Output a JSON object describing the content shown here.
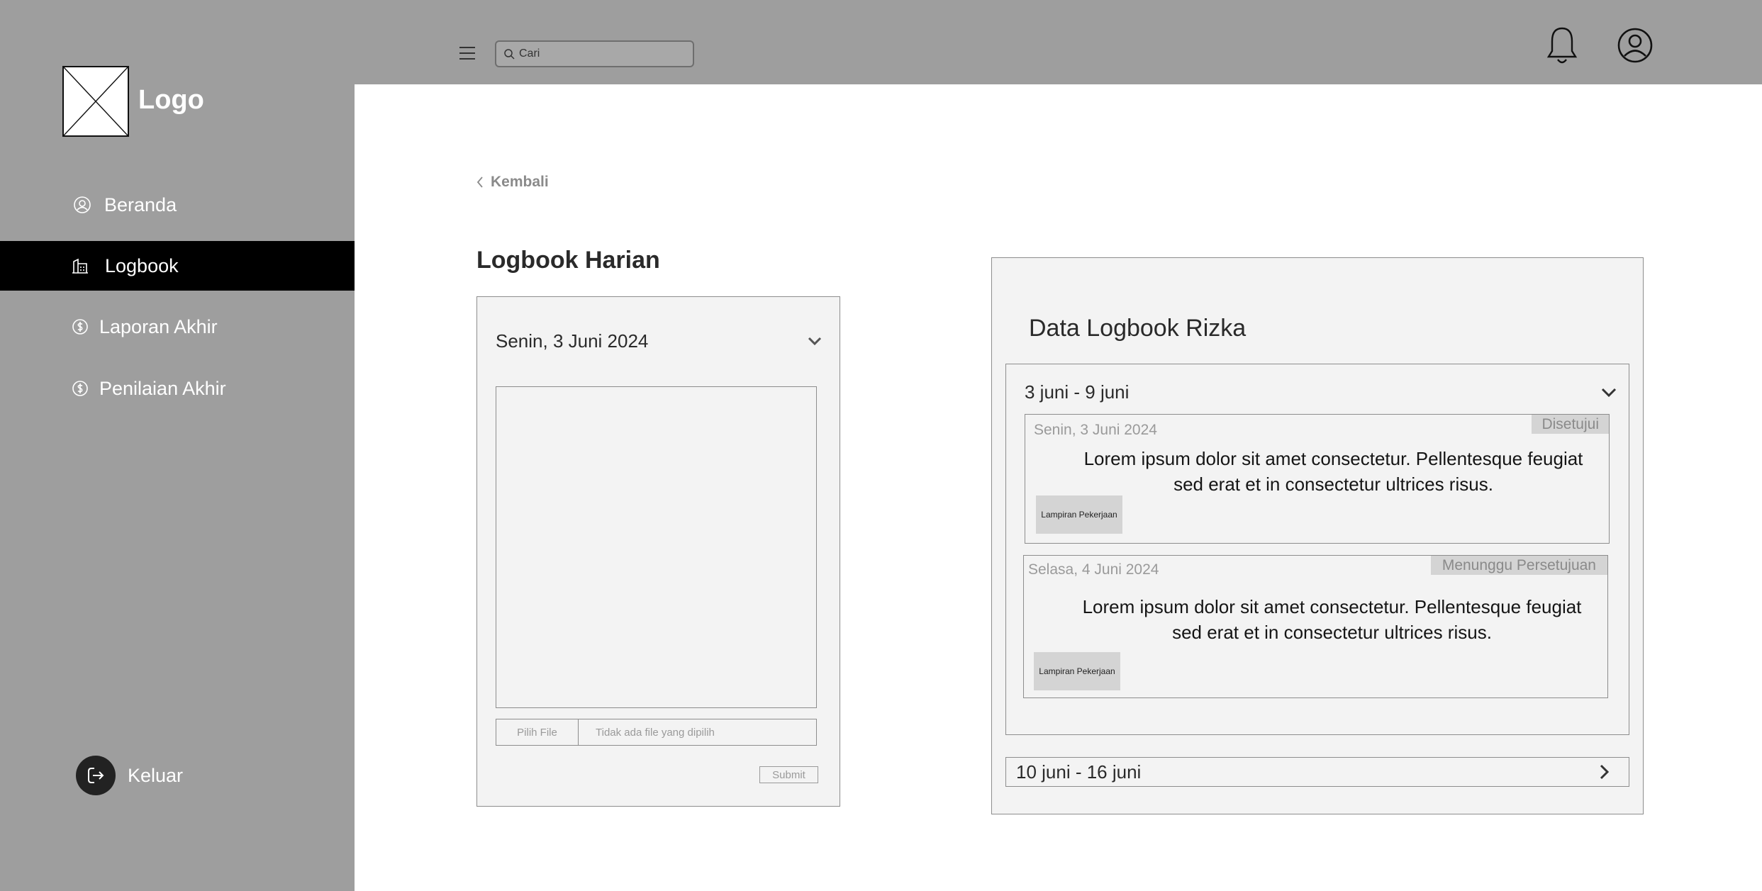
{
  "brand": {
    "logo_text": "Logo"
  },
  "sidebar": {
    "items": [
      {
        "label": "Beranda",
        "icon": "dashboard-icon",
        "active": false
      },
      {
        "label": "Logbook",
        "icon": "building-icon",
        "active": true
      },
      {
        "label": "Laporan Akhir",
        "icon": "dollar-icon",
        "active": false
      },
      {
        "label": "Penilaian Akhir",
        "icon": "dollar-icon",
        "active": false
      }
    ],
    "logout_label": "Keluar"
  },
  "topbar": {
    "search_placeholder": "Cari",
    "icons": [
      "menu-icon",
      "search-icon",
      "bell-icon",
      "user-profile-icon"
    ]
  },
  "content": {
    "back_label": "Kembali",
    "page_title": "Logbook Harian",
    "form": {
      "date_value": "Senin, 3 Juni 2024",
      "file_button": "Pilih File",
      "file_status": "Tidak ada file yang dipilih",
      "submit_label": "Submit"
    },
    "data": {
      "title": "Data Logbook Rizka",
      "weeks": [
        {
          "label": "3 juni - 9 juni",
          "expanded": true,
          "entries": [
            {
              "date": "Senin, 3 Juni 2024",
              "status": "Disetujui",
              "text": "Lorem ipsum dolor sit amet consectetur. Pellentesque feugiat sed  erat et in consectetur ultrices risus.",
              "attachment_label": "Lampiran Pekerjaan"
            },
            {
              "date": "Selasa, 4 Juni 2024",
              "status": "Menunggu Persetujuan",
              "text": "Lorem ipsum dolor sit amet consectetur. Pellentesque feugiat sed  erat et in consectetur ultrices risus.",
              "attachment_label": "Lampiran Pekerjaan"
            }
          ]
        },
        {
          "label": "10 juni - 16 juni",
          "expanded": false
        }
      ]
    }
  },
  "colors": {
    "sidebar_bg": "#9e9e9e",
    "active_nav_bg": "#000000",
    "card_bg": "#f3f3f3",
    "status_badge_bg": "#d4d4d4"
  }
}
